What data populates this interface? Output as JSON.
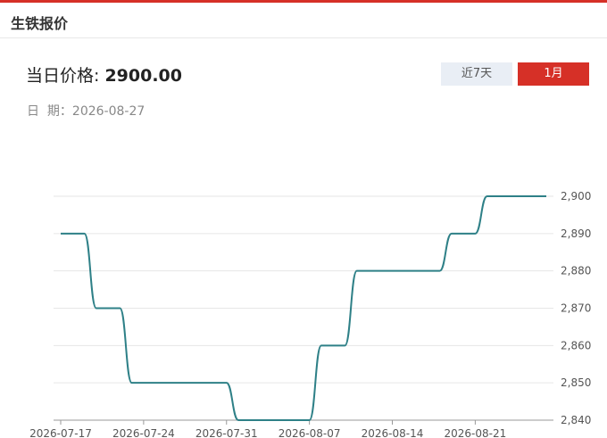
{
  "header": {
    "title": "生铁报价"
  },
  "price": {
    "label": "当日价格: ",
    "value": "2900.00"
  },
  "date": {
    "label": "日  期：",
    "value": "2026-08-27"
  },
  "tabs": [
    {
      "label": "近7天",
      "active": false
    },
    {
      "label": "1月",
      "active": true
    }
  ],
  "colors": {
    "accent": "#d63027",
    "line": "#2e8087",
    "grid": "#e6e6e6"
  },
  "chart_data": {
    "type": "line",
    "title": "",
    "xlabel": "",
    "ylabel": "",
    "x": [
      "2026-07-17",
      "2026-07-18",
      "2026-07-19",
      "2026-07-20",
      "2026-07-21",
      "2026-07-22",
      "2026-07-23",
      "2026-07-24",
      "2026-07-25",
      "2026-07-26",
      "2026-07-27",
      "2026-07-28",
      "2026-07-29",
      "2026-07-30",
      "2026-07-31",
      "2026-08-01",
      "2026-08-02",
      "2026-08-03",
      "2026-08-04",
      "2026-08-05",
      "2026-08-06",
      "2026-08-07",
      "2026-08-08",
      "2026-08-09",
      "2026-08-10",
      "2026-08-11",
      "2026-08-12",
      "2026-08-13",
      "2026-08-14",
      "2026-08-15",
      "2026-08-16",
      "2026-08-17",
      "2026-08-18",
      "2026-08-19",
      "2026-08-20",
      "2026-08-21",
      "2026-08-22",
      "2026-08-23",
      "2026-08-24",
      "2026-08-25",
      "2026-08-26",
      "2026-08-27"
    ],
    "x_ticks": [
      "2026-07-17",
      "2026-07-24",
      "2026-07-31",
      "2026-08-07",
      "2026-08-14",
      "2026-08-21"
    ],
    "series": [
      {
        "values": [
          2890,
          2890,
          2890,
          2870,
          2870,
          2870,
          2850,
          2850,
          2850,
          2850,
          2850,
          2850,
          2850,
          2850,
          2850,
          2840,
          2840,
          2840,
          2840,
          2840,
          2840,
          2840,
          2860,
          2860,
          2860,
          2880,
          2880,
          2880,
          2880,
          2880,
          2880,
          2880,
          2880,
          2890,
          2890,
          2890,
          2900,
          2900,
          2900,
          2900,
          2900,
          2900
        ]
      }
    ],
    "y_ticks": [
      "2,840",
      "2,850",
      "2,860",
      "2,870",
      "2,880",
      "2,890",
      "2,900"
    ],
    "ylim": [
      2840,
      2900
    ],
    "grid": true,
    "y_axis_side": "right"
  }
}
